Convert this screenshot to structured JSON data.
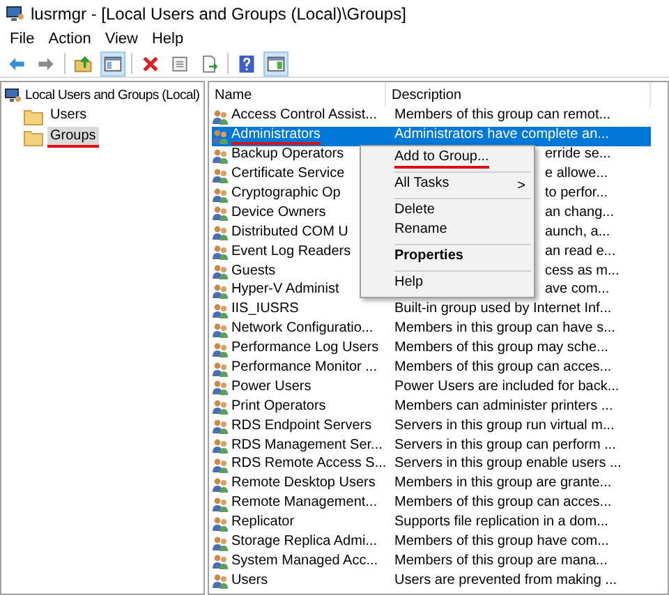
{
  "window": {
    "title": "lusrmgr - [Local Users and Groups (Local)\\Groups]"
  },
  "menu": [
    "File",
    "Action",
    "View",
    "Help"
  ],
  "toolbar": [
    {
      "kind": "back",
      "selected": false
    },
    {
      "kind": "forward",
      "selected": false
    },
    {
      "kind": "sep"
    },
    {
      "kind": "up",
      "selected": false
    },
    {
      "kind": "tree",
      "selected": true
    },
    {
      "kind": "sep"
    },
    {
      "kind": "delete",
      "selected": false
    },
    {
      "kind": "properties",
      "selected": false
    },
    {
      "kind": "export",
      "selected": false
    },
    {
      "kind": "sep"
    },
    {
      "kind": "help",
      "selected": false
    },
    {
      "kind": "pane",
      "selected": true
    }
  ],
  "tree": {
    "label": "Local Users and Groups (Local)",
    "children": [
      {
        "label": "Users",
        "selected": false,
        "underlined": false
      },
      {
        "label": "Groups",
        "selected": true,
        "underlined": true
      }
    ]
  },
  "table": {
    "columns": [
      "Name",
      "Description"
    ],
    "rows": [
      {
        "name": "Access Control Assist...",
        "description": "Members of this group can remot...",
        "selected": false,
        "underlined": false
      },
      {
        "name": "Administrators",
        "description": "Administrators have complete an...",
        "selected": true,
        "underlined": true
      },
      {
        "name": "Backup Operators",
        "description_tail": "erride se...",
        "selected": false,
        "underlined": false
      },
      {
        "name": "Certificate Service",
        "description_tail": "e allowe...",
        "selected": false,
        "underlined": false
      },
      {
        "name": "Cryptographic Op",
        "description_tail": "to perfor...",
        "selected": false,
        "underlined": false
      },
      {
        "name": "Device Owners",
        "description_tail": "an chang...",
        "selected": false,
        "underlined": false
      },
      {
        "name": "Distributed COM U",
        "description_tail": "aunch, a...",
        "selected": false,
        "underlined": false
      },
      {
        "name": "Event Log Readers",
        "description_tail": "an read e...",
        "selected": false,
        "underlined": false
      },
      {
        "name": "Guests",
        "description_tail": "cess as m...",
        "selected": false,
        "underlined": false
      },
      {
        "name": "Hyper-V Administ",
        "description_tail": "ave com...",
        "selected": false,
        "underlined": false
      },
      {
        "name": "IIS_IUSRS",
        "description": "Built-in group used by Internet Inf...",
        "selected": false,
        "underlined": false
      },
      {
        "name": "Network Configuratio...",
        "description": "Members in this group can have s...",
        "selected": false,
        "underlined": false
      },
      {
        "name": "Performance Log Users",
        "description": "Members of this group may sche...",
        "selected": false,
        "underlined": false
      },
      {
        "name": "Performance Monitor ...",
        "description": "Members of this group can acces...",
        "selected": false,
        "underlined": false
      },
      {
        "name": "Power Users",
        "description": "Power Users are included for back...",
        "selected": false,
        "underlined": false
      },
      {
        "name": "Print Operators",
        "description": "Members can administer printers ...",
        "selected": false,
        "underlined": false
      },
      {
        "name": "RDS Endpoint Servers",
        "description": "Servers in this group run virtual m...",
        "selected": false,
        "underlined": false
      },
      {
        "name": "RDS Management Ser...",
        "description": "Servers in this group can perform ...",
        "selected": false,
        "underlined": false
      },
      {
        "name": "RDS Remote Access S...",
        "description": "Servers in this group enable users ...",
        "selected": false,
        "underlined": false
      },
      {
        "name": "Remote Desktop Users",
        "description": "Members in this group are grante...",
        "selected": false,
        "underlined": false
      },
      {
        "name": "Remote Management...",
        "description": "Members of this group can acces...",
        "selected": false,
        "underlined": false
      },
      {
        "name": "Replicator",
        "description": "Supports file replication in a dom...",
        "selected": false,
        "underlined": false
      },
      {
        "name": "Storage Replica Admi...",
        "description": "Members of this group have com...",
        "selected": false,
        "underlined": false
      },
      {
        "name": "System Managed Acc...",
        "description": "Members of this group are mana...",
        "selected": false,
        "underlined": false
      },
      {
        "name": "Users",
        "description": "Users are prevented from making ...",
        "selected": false,
        "underlined": false
      }
    ]
  },
  "context_menu": [
    {
      "kind": "item",
      "label": "Add to Group...",
      "bold": false,
      "underlined": true
    },
    {
      "kind": "separator"
    },
    {
      "kind": "submenu",
      "label": "All Tasks",
      "arrow": ">",
      "bold": false,
      "underlined": false
    },
    {
      "kind": "separator"
    },
    {
      "kind": "item",
      "label": "Delete",
      "bold": false,
      "underlined": false
    },
    {
      "kind": "item",
      "label": "Rename",
      "bold": false,
      "underlined": false
    },
    {
      "kind": "separator"
    },
    {
      "kind": "item",
      "label": "Properties",
      "bold": true,
      "underlined": false
    },
    {
      "kind": "separator"
    },
    {
      "kind": "item",
      "label": "Help",
      "bold": false,
      "underlined": false
    }
  ]
}
